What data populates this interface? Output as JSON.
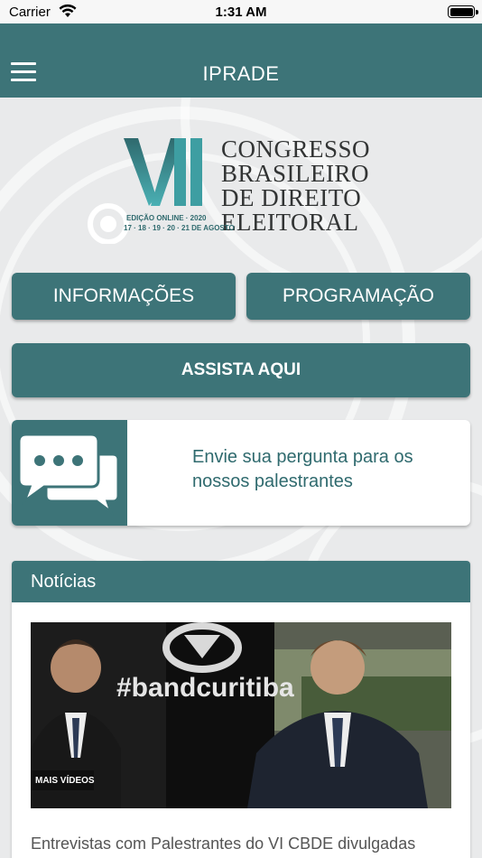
{
  "status_bar": {
    "carrier": "Carrier",
    "time": "1:31 AM"
  },
  "nav": {
    "title": "IPRADE",
    "menu_icon": "hamburger-menu-icon"
  },
  "logo": {
    "numeral": "VII",
    "lines": [
      "CONGRESSO",
      "BRASILEIRO",
      "DE DIREITO",
      "ELEITORAL"
    ],
    "edition": "EDIÇÃO ONLINE · 2020",
    "dates": "17 · 18 · 19 · 20 · 21 DE AGOSTO"
  },
  "buttons": {
    "info": "INFORMAÇÕES",
    "program": "PROGRAMAÇÃO",
    "watch": "ASSISTA AQUI"
  },
  "question": {
    "icon": "chat-bubbles-icon",
    "text": "Envie sua pergunta para os nossos palestrantes"
  },
  "news": {
    "header": "Notícias",
    "items": [
      {
        "image_text": "#bandcuritiba",
        "badge": "MAIS VÍDEOS",
        "caption": "Entrevistas com Palestrantes do VI CBDE divulgadas"
      }
    ]
  },
  "colors": {
    "primary": "#3d7478",
    "accent_text": "#2f6a6e",
    "background": "#e9eaeb"
  }
}
